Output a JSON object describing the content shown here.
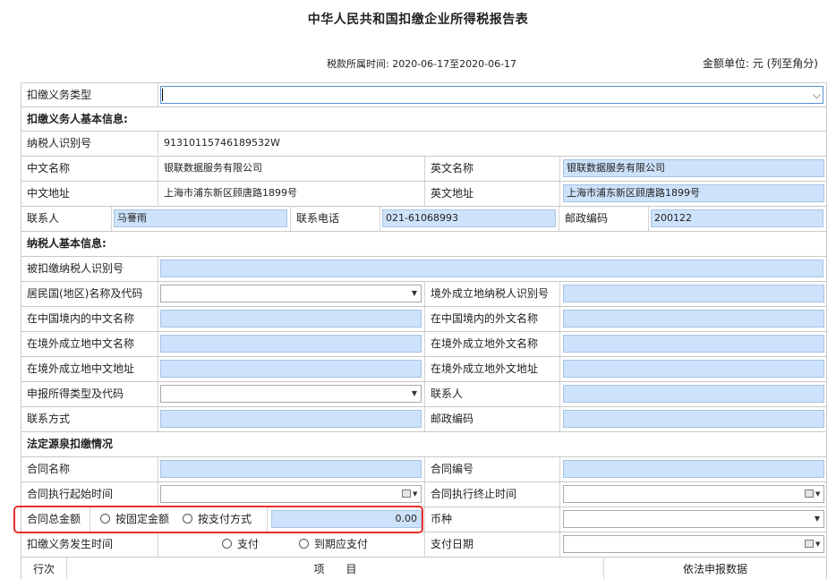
{
  "header": {
    "title": "中华人民共和国扣缴企业所得税报告表",
    "period": "税款所属时间: 2020-06-17至2020-06-17",
    "unit": "金额单位: 元 (列至角分)"
  },
  "withholder_type": {
    "label": "扣缴义务类型",
    "value": ""
  },
  "section_withholder": "扣缴义务人基本信息:",
  "withholder": {
    "tax_id_label": "纳税人识别号",
    "tax_id": "91310115746189532W",
    "cn_name_label": "中文名称",
    "cn_name": "银联数据服务有限公司",
    "en_name_label": "英文名称",
    "en_name": "银联数据服务有限公司",
    "cn_addr_label": "中文地址",
    "cn_addr": "上海市浦东新区顾唐路1899号",
    "en_addr_label": "英文地址",
    "en_addr": "上海市浦东新区顾唐路1899号",
    "contact_label": "联系人",
    "contact": "马謇雨",
    "phone_label": "联系电话",
    "phone": "021-61068993",
    "postcode_label": "邮政编码",
    "postcode": "200122"
  },
  "section_taxpayer": "纳税人基本信息:",
  "taxpayer": {
    "withheld_id_label": "被扣缴纳税人识别号",
    "residence_label": "居民国(地区)名称及代码",
    "foreign_tax_id_label": "境外成立地纳税人识别号",
    "cn_name_in_china_label": "在中国境内的中文名称",
    "foreign_name_in_china_label": "在中国境内的外文名称",
    "cn_name_abroad_label": "在境外成立地中文名称",
    "foreign_name_abroad_label": "在境外成立地外文名称",
    "cn_addr_abroad_label": "在境外成立地中文地址",
    "foreign_addr_abroad_label": "在境外成立地外文地址",
    "income_type_label": "申报所得类型及代码",
    "contact_label": "联系人",
    "contact_method_label": "联系方式",
    "postcode_label": "邮政编码"
  },
  "section_statutory": "法定源泉扣缴情况",
  "statutory": {
    "contract_name_label": "合同名称",
    "contract_no_label": "合同编号",
    "start_label": "合同执行起始时间",
    "end_label": "合同执行终止时间",
    "total_label": "合同总金额",
    "fixed_amount_label": "按固定金额",
    "payment_method_label": "按支付方式",
    "total_value": "0.00",
    "currency_label": "币种",
    "occur_time_label": "扣缴义务发生时间",
    "pay_label": "支付",
    "due_pay_label": "到期应支付",
    "pay_date_label": "支付日期"
  },
  "table_header": {
    "col_row": "行次",
    "col_item": "项　　目",
    "col_data": "依法申报数据"
  },
  "colors": {
    "input_blue": "#cde2fb",
    "highlight": "#e8302a"
  }
}
